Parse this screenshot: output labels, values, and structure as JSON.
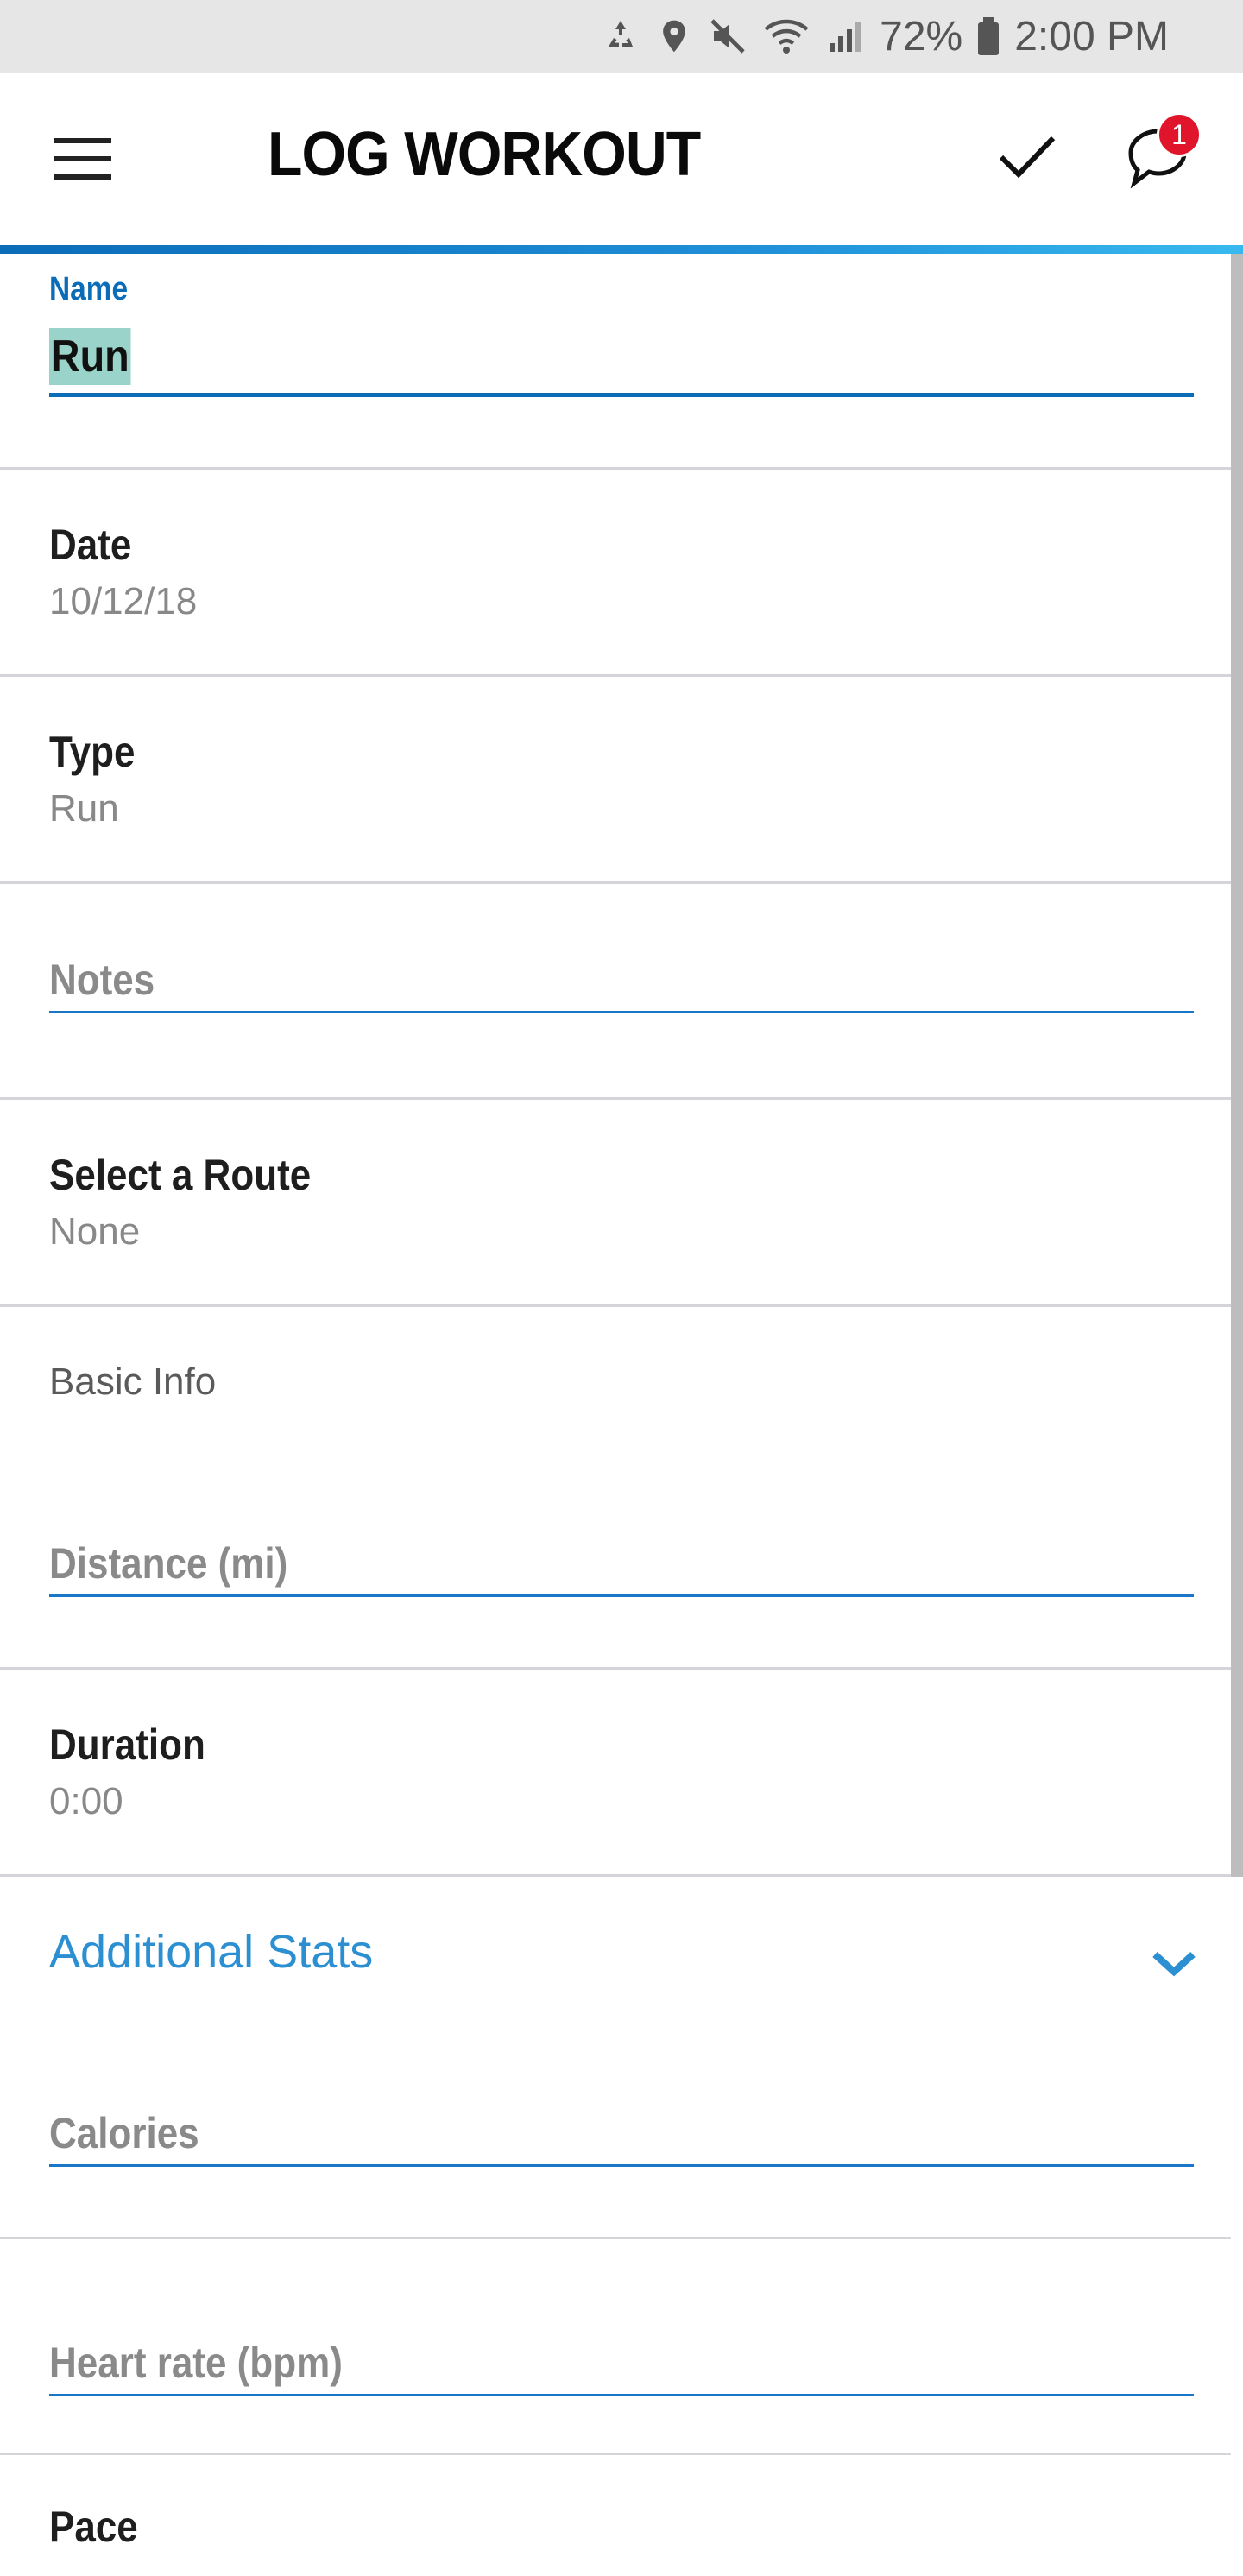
{
  "status_bar": {
    "battery_percent": "72%",
    "time": "2:00 PM",
    "icons": [
      "recycle-icon",
      "location-icon",
      "mute-icon",
      "wifi-icon",
      "signal-icon",
      "battery-icon"
    ]
  },
  "app_bar": {
    "title": "LOG WORKOUT",
    "notification_count": "1",
    "icons": [
      "menu-icon",
      "check-icon",
      "chat-bubble-icon"
    ]
  },
  "form": {
    "name": {
      "label": "Name",
      "value": "Run"
    },
    "date": {
      "label": "Date",
      "value": "10/12/18"
    },
    "type": {
      "label": "Type",
      "value": "Run"
    },
    "notes": {
      "placeholder": "Notes"
    },
    "route": {
      "label": "Select a Route",
      "value": "None"
    },
    "basic_info": {
      "heading": "Basic Info",
      "distance_placeholder": "Distance (mi)"
    },
    "duration": {
      "label": "Duration",
      "value": "0:00"
    },
    "additional_stats": {
      "heading": "Additional Stats",
      "calories_placeholder": "Calories",
      "heart_rate_placeholder": "Heart rate (bpm)"
    },
    "pace": {
      "label": "Pace"
    }
  },
  "colors": {
    "accent": "#0b6cb8",
    "link": "#2b8fd1",
    "badge": "#e0142a",
    "selection": "#9ad3c9"
  }
}
